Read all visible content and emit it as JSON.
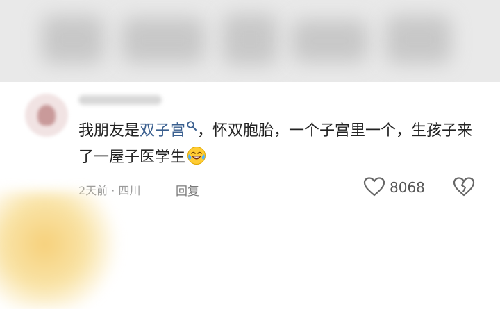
{
  "comment": {
    "text_before": "我朋友是",
    "highlight": "双子宫",
    "text_after": "，怀双胞胎，一个子宫里一个，生孩子来了一屋子医学生",
    "meta": "2天前 · 四川",
    "reply_label": "回复",
    "like_count": "8068"
  },
  "icons": {
    "search": "search-icon",
    "emoji": "laughing-tears-emoji",
    "like": "heart-icon",
    "dislike": "broken-heart-icon"
  },
  "colors": {
    "highlight": "#3a5f8f",
    "text": "#222222",
    "meta": "#9b9b9b"
  }
}
